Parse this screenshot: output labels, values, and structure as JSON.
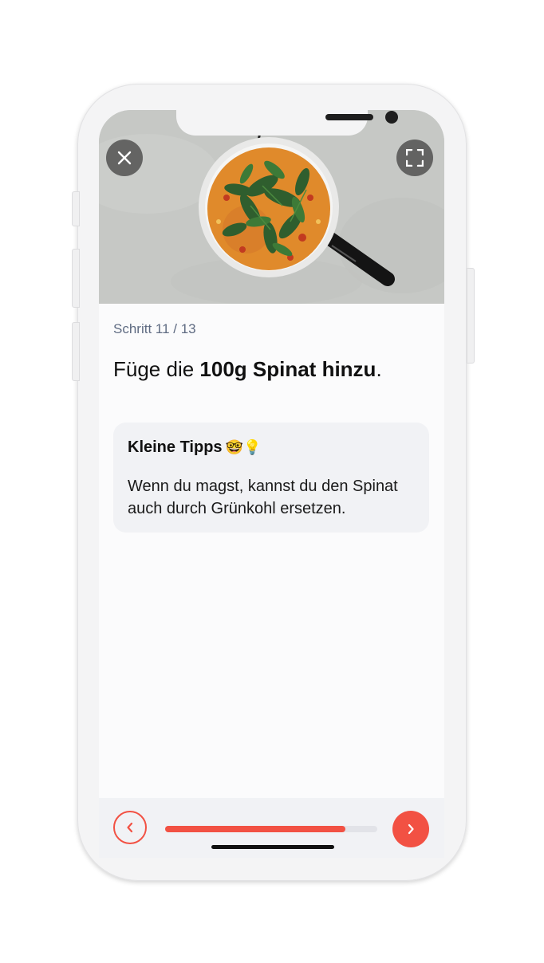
{
  "step": {
    "label": "Schritt 11 / 13",
    "title_prefix": "Füge die ",
    "title_bold": "100g Spinat hinzu",
    "title_suffix": "."
  },
  "tip": {
    "title": "Kleine Tipps",
    "emoji": "🤓💡",
    "text": "Wenn du magst, kannst du den Spinat auch durch Grünkohl ersetzen."
  },
  "hero": {
    "image": "pan-with-spinach"
  },
  "icons": {
    "close": "close-icon",
    "fullscreen": "fullscreen-icon",
    "prev": "chevron-left-icon",
    "next": "chevron-right-icon"
  },
  "progress": {
    "fraction": 0.85
  },
  "colors": {
    "accent": "#f25143",
    "step_label": "#5f6b82",
    "card_bg": "#f1f2f5"
  }
}
